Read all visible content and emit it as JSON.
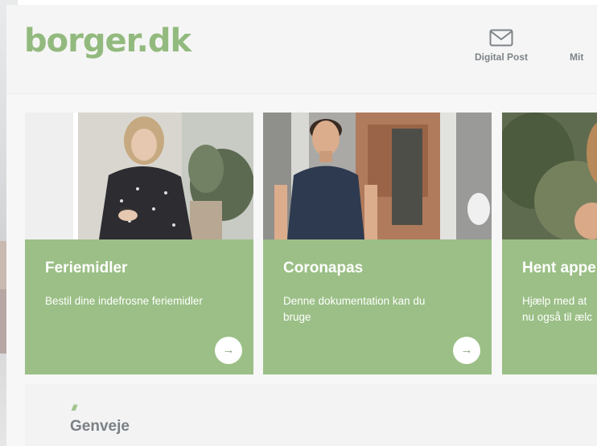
{
  "logo": "borger.dk",
  "nav": {
    "digital_post": "Digital Post",
    "mit": "Mit"
  },
  "cards": [
    {
      "title": "Feriemidler",
      "desc": "Bestil dine indefrosne feriemidler",
      "arrow": "→"
    },
    {
      "title": "Coronapas",
      "desc": "Denne dokumentation kan du\nbruge",
      "arrow": "→"
    },
    {
      "title": "Hent appe",
      "desc": "Hjælp med at\nnu også til ælc"
    }
  ],
  "shortcuts": {
    "title": "Genveje",
    "decoration": "//////"
  },
  "colors": {
    "brand_green": "#93ba7e",
    "card_green": "#9bbf86",
    "header_bg": "#f5f5f5"
  }
}
